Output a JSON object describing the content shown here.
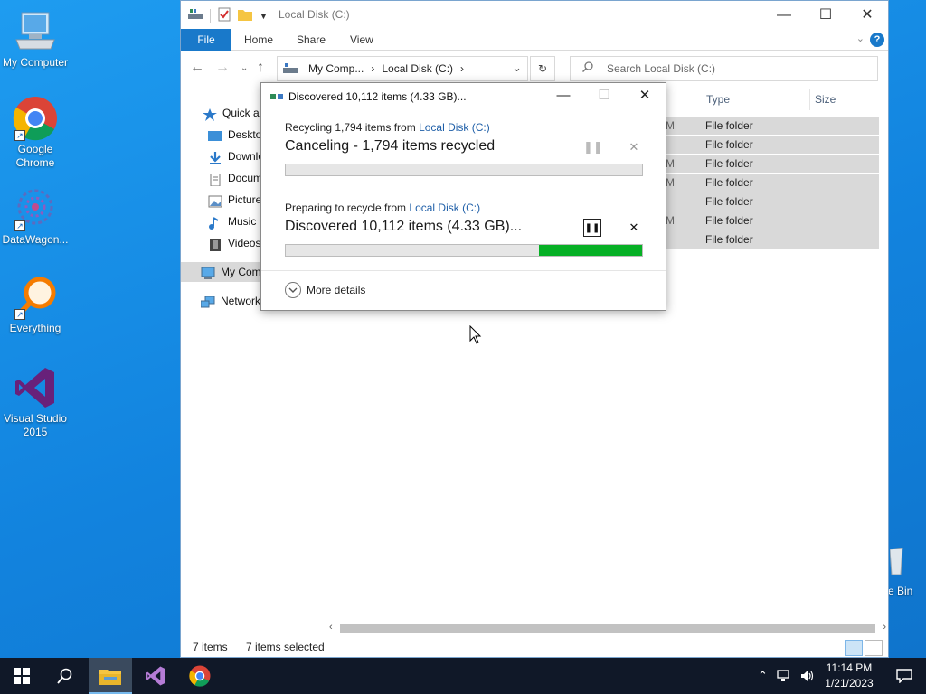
{
  "desktop": {
    "icons": [
      {
        "label": "My Computer",
        "icon": "computer-icon"
      },
      {
        "label": "Google Chrome",
        "icon": "chrome-icon"
      },
      {
        "label": "DataWagon...",
        "icon": "datawagon-icon"
      },
      {
        "label": "Everything",
        "icon": "everything-search-icon"
      },
      {
        "label": "Visual Studio 2015",
        "icon": "visual-studio-icon"
      }
    ],
    "recycle_bin_label": "e Bin"
  },
  "explorer": {
    "title": "Local Disk (C:)",
    "tabs": {
      "file": "File",
      "home": "Home",
      "share": "Share",
      "view": "View"
    },
    "address": {
      "part1": "My Comp...",
      "sep": "›",
      "part2": "Local Disk (C:)",
      "tail": "›"
    },
    "search_placeholder": "Search Local Disk (C:)",
    "nav": {
      "quick_access": "Quick ac",
      "desktop": "Deskto",
      "downloads": "Downlo",
      "documents": "Docum",
      "pictures": "Picture",
      "music": "Music",
      "videos": "Videos",
      "my_computer": "My Com",
      "network": "Network"
    },
    "columns": {
      "type": "Type",
      "size": "Size"
    },
    "rows": [
      {
        "m": "M",
        "type": "File folder"
      },
      {
        "m": "",
        "type": "File folder"
      },
      {
        "m": "M",
        "type": "File folder"
      },
      {
        "m": "M",
        "type": "File folder"
      },
      {
        "m": "",
        "type": "File folder"
      },
      {
        "m": "M",
        "type": "File folder"
      },
      {
        "m": "",
        "type": "File folder"
      }
    ],
    "status": {
      "count": "7 items",
      "selected": "7 items selected"
    }
  },
  "dialog": {
    "title": "Discovered 10,112 items (4.33 GB)...",
    "op1": {
      "prefix": "Recycling 1,794 items from ",
      "link": "Local Disk (C:)",
      "headline": "Canceling - 1,794 items recycled",
      "progress": 0
    },
    "op2": {
      "prefix": "Preparing to recycle from ",
      "link": "Local Disk (C:)",
      "headline": "Discovered 10,112 items (4.33 GB)...",
      "progress": 0.29
    },
    "more_details": "More details"
  },
  "taskbar": {
    "time": "11:14 PM",
    "date": "1/21/2023",
    "accent": "#76b9ed"
  }
}
